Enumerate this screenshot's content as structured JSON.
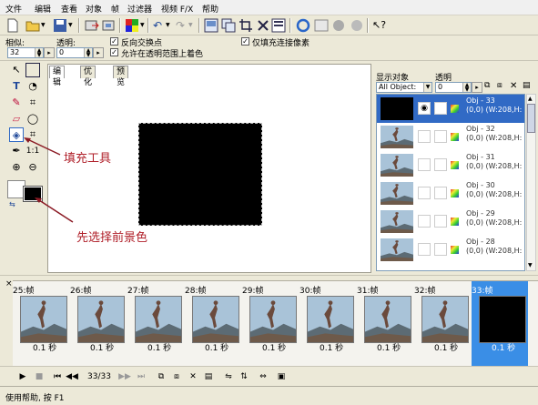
{
  "menu": [
    "文件",
    "编辑",
    "查看",
    "对象",
    "帧",
    "过滤器",
    "视频 F/X",
    "帮助"
  ],
  "options": {
    "tolerance_label": "相似:",
    "tolerance_value": "32",
    "opacity_label": "透明:",
    "opacity_value": "0",
    "reverse_label": "反向交换点",
    "allow_label": "允许在透明范围上着色",
    "connected_label": "仅填充连接像素"
  },
  "canvas_tabs": [
    "编辑",
    "优化",
    "预览"
  ],
  "right_panel": {
    "show_label": "显示对象",
    "opacity_label": "透明",
    "filter_value": "All Object:",
    "opacity_value": "0"
  },
  "objects": [
    {
      "name": "Obj - 33",
      "info": "(0,0) (W:208,H:",
      "type": "black",
      "selected": true
    },
    {
      "name": "Obj - 32",
      "info": "(0,0) (W:208,H:",
      "type": "photo",
      "selected": false
    },
    {
      "name": "Obj - 31",
      "info": "(0,0) (W:208,H:",
      "type": "photo",
      "selected": false
    },
    {
      "name": "Obj - 30",
      "info": "(0,0) (W:208,H:",
      "type": "photo",
      "selected": false
    },
    {
      "name": "Obj - 29",
      "info": "(0,0) (W:208,H:",
      "type": "photo",
      "selected": false
    },
    {
      "name": "Obj - 28",
      "info": "(0,0) (W:208,H:",
      "type": "photo",
      "selected": false
    }
  ],
  "frames": [
    {
      "label": "25:帧",
      "duration": "0.1 秒",
      "type": "photo",
      "selected": false
    },
    {
      "label": "26:帧",
      "duration": "0.1 秒",
      "type": "photo",
      "selected": false
    },
    {
      "label": "27:帧",
      "duration": "0.1 秒",
      "type": "photo",
      "selected": false
    },
    {
      "label": "28:帧",
      "duration": "0.1 秒",
      "type": "photo",
      "selected": false
    },
    {
      "label": "29:帧",
      "duration": "0.1 秒",
      "type": "photo",
      "selected": false
    },
    {
      "label": "30:帧",
      "duration": "0.1 秒",
      "type": "photo",
      "selected": false
    },
    {
      "label": "31:帧",
      "duration": "0.1 秒",
      "type": "photo",
      "selected": false
    },
    {
      "label": "32:帧",
      "duration": "0.1 秒",
      "type": "photo",
      "selected": false
    },
    {
      "label": "33:帧",
      "duration": "0.1 秒",
      "type": "black",
      "selected": true
    }
  ],
  "playback": {
    "frame_counter": "33/33"
  },
  "status": "使用帮助, 按 F1",
  "annotations": {
    "fill_tool": "填充工具",
    "fg_color": "先选择前景色"
  },
  "colors": {
    "accent": "#316ac5",
    "annotation": "#b0202a",
    "frame_selected": "#3a8ee6"
  },
  "icons": [
    "new-icon",
    "open-icon",
    "save-icon",
    "export-icon",
    "import-icon",
    "color-icon",
    "undo-icon",
    "redo-icon",
    "crop-icon",
    "delete-icon",
    "ie-icon",
    "help-icon"
  ]
}
